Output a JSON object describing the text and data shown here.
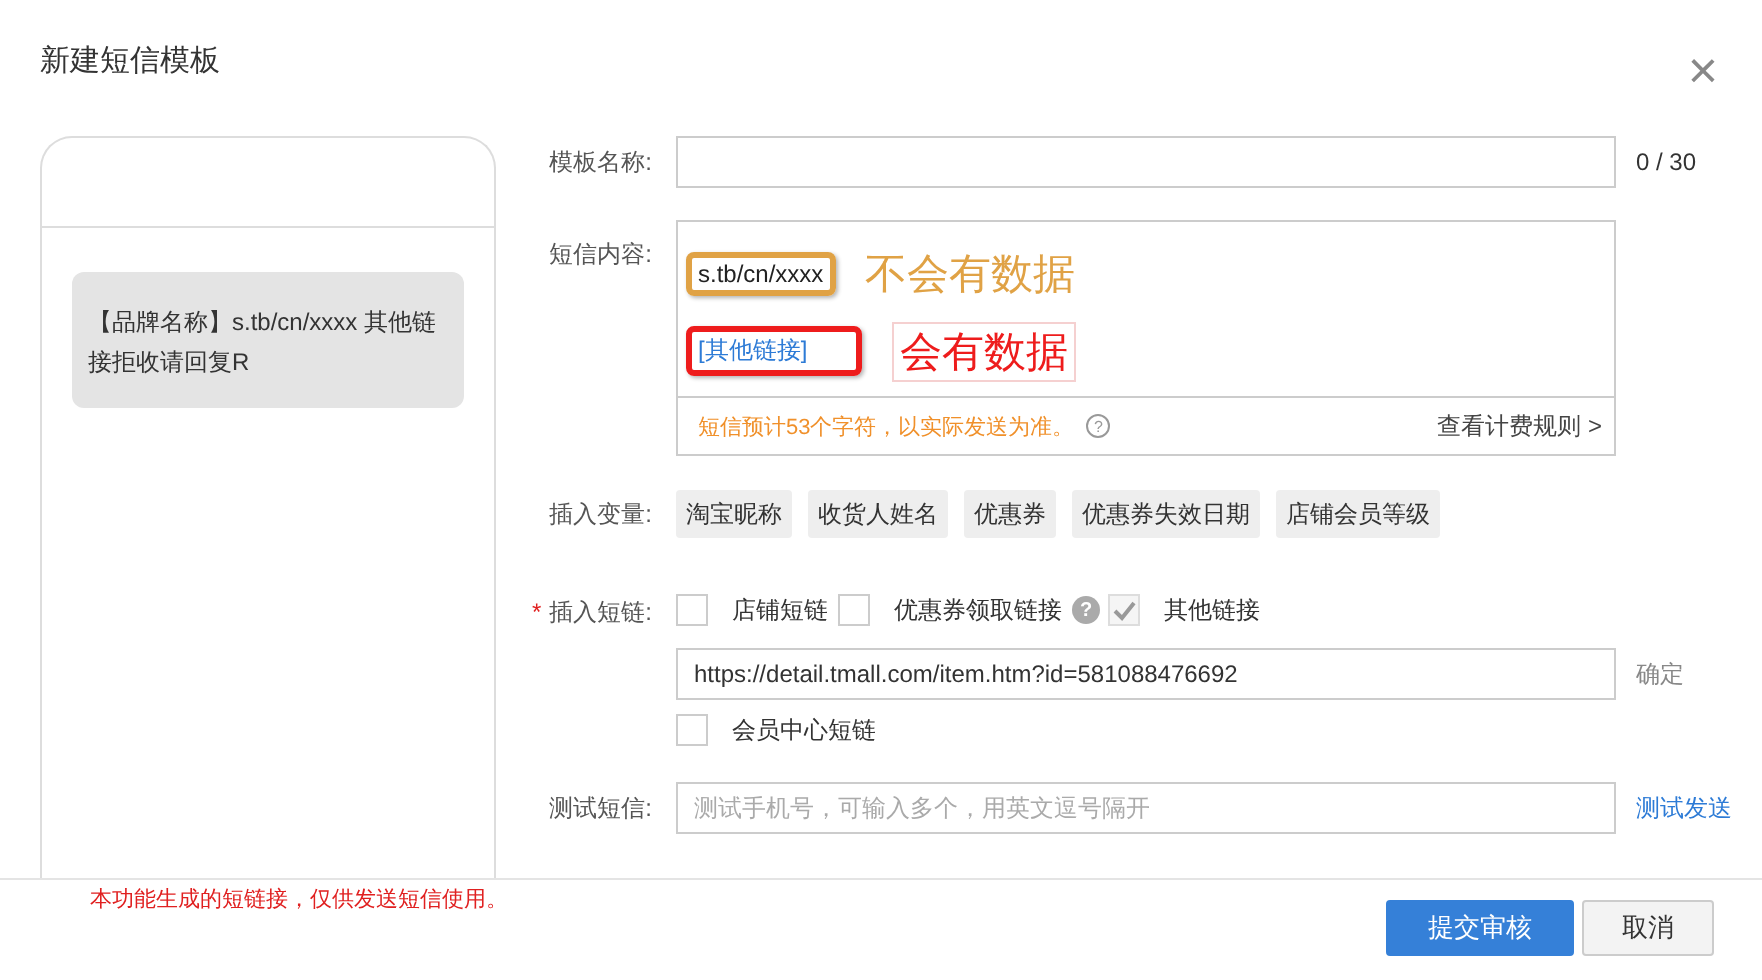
{
  "dialog": {
    "title": "新建短信模板",
    "close": "×"
  },
  "preview": {
    "message": "【品牌名称】s.tb/cn/xxxx 其他链接拒收请回复R"
  },
  "name_field": {
    "label": "模板名称:",
    "counter": "0 / 30"
  },
  "content": {
    "label": "短信内容:",
    "lines": [
      {
        "kind": "plain",
        "token": "s.tb/cn/xxxx",
        "note": "不会有数据",
        "color": "#e0a245"
      },
      {
        "kind": "link",
        "token": "[其他链接]",
        "note": "会有数据",
        "color": "#ee1c1c"
      }
    ],
    "estimate": "短信预计53个字符，以实际发送为准。",
    "help": "?",
    "rules_link": "查看计费规则 >"
  },
  "variables": {
    "label": "插入变量:",
    "chips": [
      "淘宝昵称",
      "收货人姓名",
      "优惠券",
      "优惠券失效日期",
      "店铺会员等级"
    ]
  },
  "short_links": {
    "label": "插入短链:",
    "required_mark": "*",
    "options": [
      {
        "label": "店铺短链",
        "checked": false,
        "disabled": false
      },
      {
        "label": "优惠券领取链接",
        "checked": false,
        "disabled": false,
        "help": "?"
      },
      {
        "label": "其他链接",
        "checked": true,
        "disabled": true
      }
    ],
    "url": "https://detail.tmall.com/item.htm?id=581088476692",
    "confirm": "确定",
    "extra": {
      "label": "会员中心短链",
      "checked": false,
      "disabled": false
    }
  },
  "test": {
    "label": "测试短信:",
    "placeholder": "测试手机号，可输入多个，用英文逗号隔开",
    "send": "测试发送"
  },
  "footer": {
    "note": "本功能生成的短链接，仅供发送短信使用。",
    "buttons": [
      {
        "label": "提交审核",
        "kind": "primary"
      },
      {
        "label": "取消",
        "kind": "default"
      }
    ]
  }
}
